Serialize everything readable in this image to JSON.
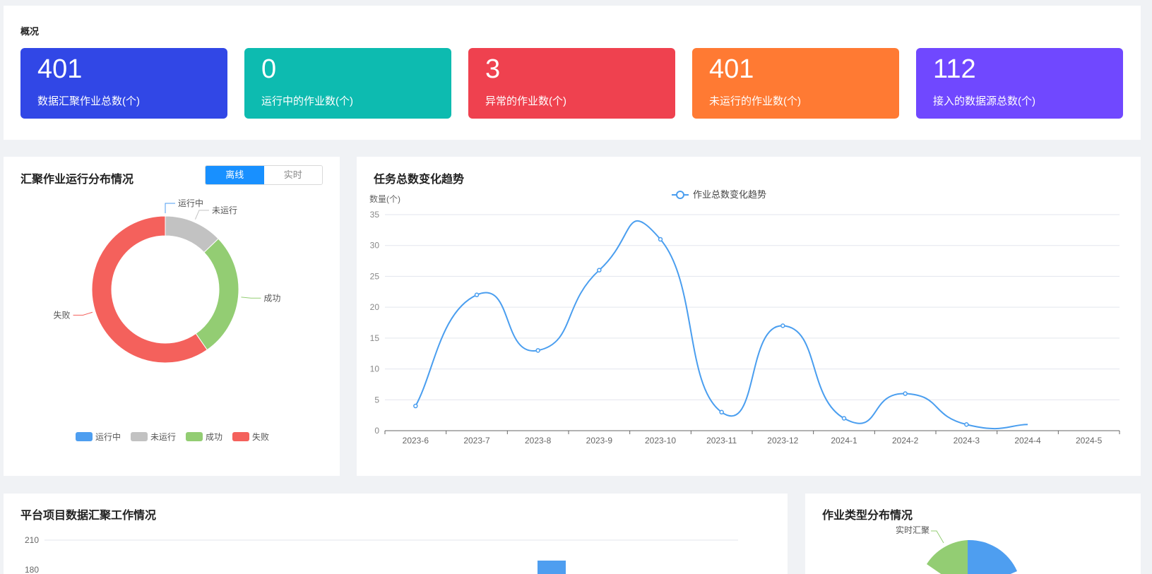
{
  "overview": {
    "title": "概况",
    "cards": [
      {
        "value": "401",
        "label": "数据汇聚作业总数(个)",
        "color": "#3147e6"
      },
      {
        "value": "0",
        "label": "运行中的作业数(个)",
        "color": "#0dbbb0"
      },
      {
        "value": "3",
        "label": "异常的作业数(个)",
        "color": "#ef414f"
      },
      {
        "value": "401",
        "label": "未运行的作业数(个)",
        "color": "#ff7a33"
      },
      {
        "value": "112",
        "label": "接入的数据源总数(个)",
        "color": "#7048ff"
      }
    ]
  },
  "distribution": {
    "title": "汇聚作业运行分布情况",
    "toggle": {
      "active": "离线",
      "inactive": "实时"
    },
    "chart_data": {
      "type": "pie",
      "categories": [
        "运行中",
        "未运行",
        "成功",
        "失败"
      ],
      "values": [
        0,
        36,
        77,
        167
      ],
      "colors": [
        "#4e9ef0",
        "#c2c2c2",
        "#93cd73",
        "#f4615c"
      ],
      "legend": "bottom"
    }
  },
  "trend": {
    "title": "任务总数变化趋势",
    "chart_data": {
      "type": "line",
      "x": [
        "2023-6",
        "2023-7",
        "2023-8",
        "2023-9",
        "2023-10",
        "2023-11",
        "2023-12",
        "2024-1",
        "2024-2",
        "2024-3",
        "2024-4",
        "2024-5"
      ],
      "series": [
        {
          "name": "作业总数变化趋势",
          "values": [
            4,
            22,
            13,
            26,
            31,
            3,
            17,
            2,
            6,
            1,
            1,
            null
          ]
        }
      ],
      "ylabel": "数量(个)",
      "ylim": [
        0,
        35
      ],
      "yticks": [
        0,
        5,
        10,
        15,
        20,
        25,
        30,
        35
      ],
      "color": "#4a9eef",
      "legend": "top"
    }
  },
  "project": {
    "title": "平台项目数据汇聚工作情况",
    "axis_ticks": [
      "210",
      "180"
    ],
    "bar_color": "#4e9ef0"
  },
  "jobtype": {
    "title": "作业类型分布情况",
    "pie_label": "实时汇聚",
    "colors": [
      "#4e9ef0",
      "#93cd73"
    ]
  }
}
